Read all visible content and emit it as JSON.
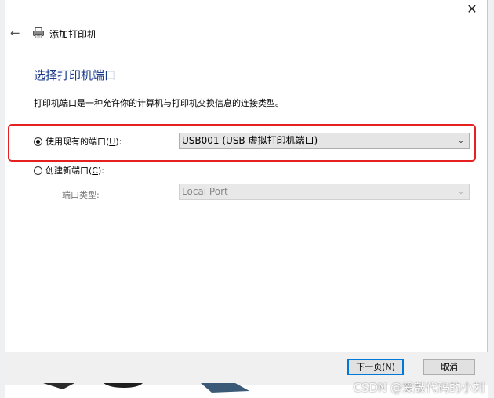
{
  "window": {
    "title": "添加打印机",
    "close_glyph": "✕",
    "back_glyph": "←"
  },
  "page": {
    "title": "选择打印机端口",
    "description": "打印机端口是一种允许你的计算机与打印机交换信息的连接类型。"
  },
  "existing_port": {
    "label_prefix": "使用现有的端口(",
    "label_key": "U",
    "label_suffix": "):",
    "selected": true,
    "value": "USB001 (USB 虚拟打印机端口)"
  },
  "new_port": {
    "label_prefix": "创建新端口(",
    "label_key": "C",
    "label_suffix": "):",
    "selected": false,
    "type_label": "端口类型:",
    "type_value": "Local Port"
  },
  "buttons": {
    "next_prefix": "下一页(",
    "next_key": "N",
    "next_suffix": ")",
    "cancel": "取消"
  },
  "watermark": "CSDN @爱敲代码的小刘",
  "colors": {
    "accent": "#0078d7",
    "title_blue": "#1a3a8a",
    "highlight_red": "#e52020"
  },
  "icons": {
    "back": "back-arrow-icon",
    "printer": "printer-icon",
    "close": "close-icon",
    "dropdown": "chevron-down-icon"
  }
}
